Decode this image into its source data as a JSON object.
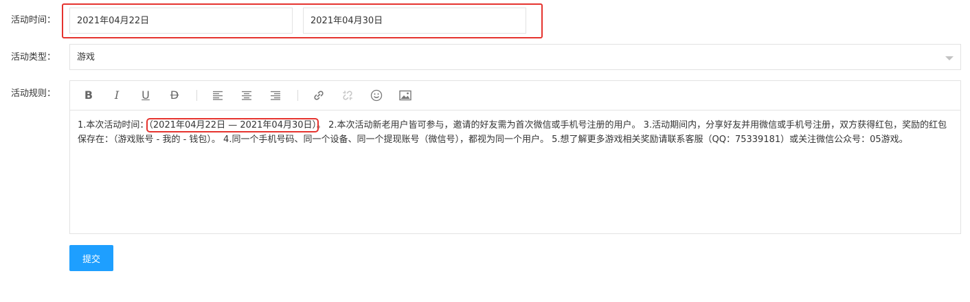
{
  "form": {
    "time_label": "活动时间：",
    "start_date": "2021年04月22日",
    "end_date": "2021年04月30日",
    "type_label": "活动类型：",
    "type_value": "游戏",
    "rules_label": "活动规则：",
    "submit_label": "提交"
  },
  "editor": {
    "toolbar": {
      "bold": "B",
      "italic": "I",
      "underline": "U",
      "strike": "D"
    },
    "content": {
      "prefix": "1.本次活动时间：",
      "highlight": "（2021年04月22日 — 2021年04月30日）",
      "rest": "。 2.本次活动新老用户皆可参与，邀请的好友需为首次微信或手机号注册的用户。 3.活动期间内，分享好友并用微信或手机号注册，双方获得红包，奖励的红包保存在：（游戏账号 - 我的 - 钱包）。 4.同一个手机号码、同一个设备、同一个提现账号（微信号），都视为同一个用户。 5.想了解更多游戏相关奖励请联系客服（QQ：75339181）或关注微信公众号：05游戏。"
    }
  },
  "colors": {
    "highlight_border": "#e5322d",
    "submit_bg": "#1e9fff",
    "border": "#e2e2e2"
  }
}
